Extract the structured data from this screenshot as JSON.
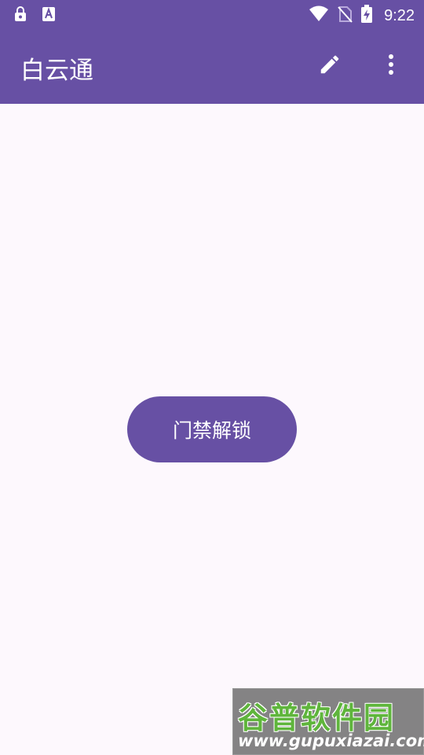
{
  "status_bar": {
    "time": "9:22",
    "left_icons": [
      "lock-icon",
      "font-icon"
    ],
    "right_icons": [
      "wifi-icon",
      "no-sim-icon",
      "battery-charging-icon"
    ]
  },
  "app_bar": {
    "title": "白云通",
    "actions": [
      "edit-icon",
      "more-vert-icon"
    ]
  },
  "main": {
    "unlock_button_label": "门禁解锁"
  },
  "watermark": {
    "name": "谷普软件园",
    "url": "www.gupuxiazai.com"
  },
  "colors": {
    "primary": "#6750a4",
    "background": "#fdf8fd",
    "on_primary": "#ffffff"
  }
}
